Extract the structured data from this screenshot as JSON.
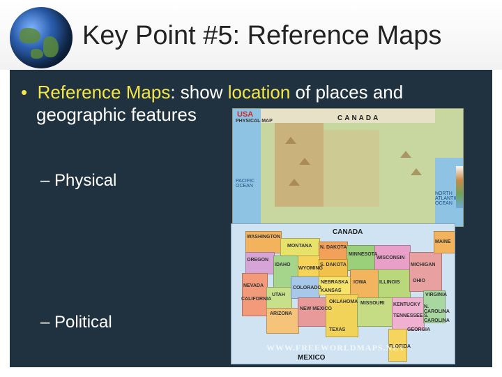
{
  "slide": {
    "title": "Key Point #5: Reference Maps",
    "bullet": {
      "term": "Reference Maps",
      "colon": ": show ",
      "highlight": "location",
      "rest1": " of places and",
      "rest2": "geographic features"
    },
    "sub_items": [
      "– Physical",
      "– Political"
    ]
  },
  "physical_map": {
    "heading": "USA",
    "subheading": "PHYSICAL MAP",
    "labels": [
      "CANADA",
      "PACIFIC OCEAN",
      "NORTH ATLANTIC OCEAN"
    ]
  },
  "political_map": {
    "labels": [
      "CANADA",
      "MEXICO",
      "WASHINGTON",
      "MONTANA",
      "N. DAKOTA",
      "S. DAKOTA",
      "OREGON",
      "IDAHO",
      "WYOMING",
      "NEBRASKA",
      "NEVADA",
      "UTAH",
      "COLORADO",
      "KANSAS",
      "CALIFORNIA",
      "ARIZONA",
      "NEW MEXICO",
      "TEXAS",
      "OKLAHOMA",
      "MISSOURI",
      "IOWA",
      "MINNESOTA",
      "WISCONSIN",
      "ILLINOIS",
      "MICHIGAN",
      "OHIO",
      "KENTUCKY",
      "TENNESSEE",
      "GEORGIA",
      "FLORIDA",
      "N. CAROLINA",
      "S. CAROLINA",
      "VIRGINIA",
      "MAINE"
    ],
    "watermark": "WWW.FREEWORLDMAPS.NET"
  },
  "colors": {
    "panel": "#20313f",
    "accent": "#f3e64a",
    "text": "#ffffff"
  }
}
